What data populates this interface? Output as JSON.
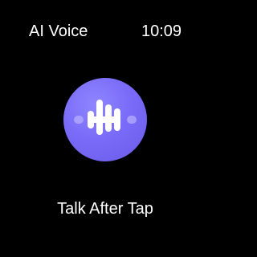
{
  "header": {
    "title": "AI Voice",
    "time": "10:09"
  },
  "main": {
    "voice_button_icon": "waveform-icon",
    "hint": "Talk After Tap"
  },
  "colors": {
    "background": "#000000",
    "text": "#ffffff",
    "accent": "#7a6cf8",
    "accent_dark": "#6a5ae8",
    "wave_faint": "#b6aeff"
  }
}
